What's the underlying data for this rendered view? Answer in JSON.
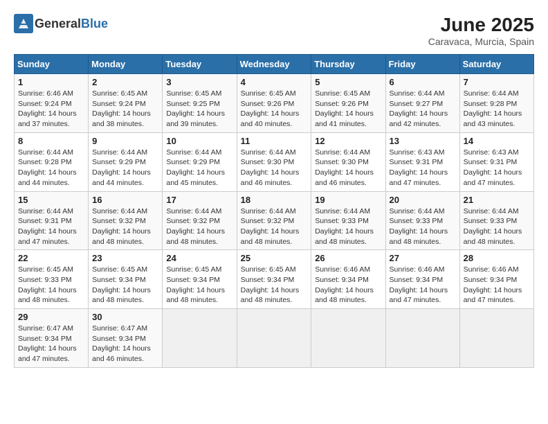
{
  "header": {
    "logo_general": "General",
    "logo_blue": "Blue",
    "month_year": "June 2025",
    "location": "Caravaca, Murcia, Spain"
  },
  "days_of_week": [
    "Sunday",
    "Monday",
    "Tuesday",
    "Wednesday",
    "Thursday",
    "Friday",
    "Saturday"
  ],
  "weeks": [
    [
      {
        "day": "1",
        "sunrise": "6:46 AM",
        "sunset": "9:24 PM",
        "daylight": "14 hours and 37 minutes."
      },
      {
        "day": "2",
        "sunrise": "6:45 AM",
        "sunset": "9:24 PM",
        "daylight": "14 hours and 38 minutes."
      },
      {
        "day": "3",
        "sunrise": "6:45 AM",
        "sunset": "9:25 PM",
        "daylight": "14 hours and 39 minutes."
      },
      {
        "day": "4",
        "sunrise": "6:45 AM",
        "sunset": "9:26 PM",
        "daylight": "14 hours and 40 minutes."
      },
      {
        "day": "5",
        "sunrise": "6:45 AM",
        "sunset": "9:26 PM",
        "daylight": "14 hours and 41 minutes."
      },
      {
        "day": "6",
        "sunrise": "6:44 AM",
        "sunset": "9:27 PM",
        "daylight": "14 hours and 42 minutes."
      },
      {
        "day": "7",
        "sunrise": "6:44 AM",
        "sunset": "9:28 PM",
        "daylight": "14 hours and 43 minutes."
      }
    ],
    [
      {
        "day": "8",
        "sunrise": "6:44 AM",
        "sunset": "9:28 PM",
        "daylight": "14 hours and 44 minutes."
      },
      {
        "day": "9",
        "sunrise": "6:44 AM",
        "sunset": "9:29 PM",
        "daylight": "14 hours and 44 minutes."
      },
      {
        "day": "10",
        "sunrise": "6:44 AM",
        "sunset": "9:29 PM",
        "daylight": "14 hours and 45 minutes."
      },
      {
        "day": "11",
        "sunrise": "6:44 AM",
        "sunset": "9:30 PM",
        "daylight": "14 hours and 46 minutes."
      },
      {
        "day": "12",
        "sunrise": "6:44 AM",
        "sunset": "9:30 PM",
        "daylight": "14 hours and 46 minutes."
      },
      {
        "day": "13",
        "sunrise": "6:43 AM",
        "sunset": "9:31 PM",
        "daylight": "14 hours and 47 minutes."
      },
      {
        "day": "14",
        "sunrise": "6:43 AM",
        "sunset": "9:31 PM",
        "daylight": "14 hours and 47 minutes."
      }
    ],
    [
      {
        "day": "15",
        "sunrise": "6:44 AM",
        "sunset": "9:31 PM",
        "daylight": "14 hours and 47 minutes."
      },
      {
        "day": "16",
        "sunrise": "6:44 AM",
        "sunset": "9:32 PM",
        "daylight": "14 hours and 48 minutes."
      },
      {
        "day": "17",
        "sunrise": "6:44 AM",
        "sunset": "9:32 PM",
        "daylight": "14 hours and 48 minutes."
      },
      {
        "day": "18",
        "sunrise": "6:44 AM",
        "sunset": "9:32 PM",
        "daylight": "14 hours and 48 minutes."
      },
      {
        "day": "19",
        "sunrise": "6:44 AM",
        "sunset": "9:33 PM",
        "daylight": "14 hours and 48 minutes."
      },
      {
        "day": "20",
        "sunrise": "6:44 AM",
        "sunset": "9:33 PM",
        "daylight": "14 hours and 48 minutes."
      },
      {
        "day": "21",
        "sunrise": "6:44 AM",
        "sunset": "9:33 PM",
        "daylight": "14 hours and 48 minutes."
      }
    ],
    [
      {
        "day": "22",
        "sunrise": "6:45 AM",
        "sunset": "9:33 PM",
        "daylight": "14 hours and 48 minutes."
      },
      {
        "day": "23",
        "sunrise": "6:45 AM",
        "sunset": "9:34 PM",
        "daylight": "14 hours and 48 minutes."
      },
      {
        "day": "24",
        "sunrise": "6:45 AM",
        "sunset": "9:34 PM",
        "daylight": "14 hours and 48 minutes."
      },
      {
        "day": "25",
        "sunrise": "6:45 AM",
        "sunset": "9:34 PM",
        "daylight": "14 hours and 48 minutes."
      },
      {
        "day": "26",
        "sunrise": "6:46 AM",
        "sunset": "9:34 PM",
        "daylight": "14 hours and 48 minutes."
      },
      {
        "day": "27",
        "sunrise": "6:46 AM",
        "sunset": "9:34 PM",
        "daylight": "14 hours and 47 minutes."
      },
      {
        "day": "28",
        "sunrise": "6:46 AM",
        "sunset": "9:34 PM",
        "daylight": "14 hours and 47 minutes."
      }
    ],
    [
      {
        "day": "29",
        "sunrise": "6:47 AM",
        "sunset": "9:34 PM",
        "daylight": "14 hours and 47 minutes."
      },
      {
        "day": "30",
        "sunrise": "6:47 AM",
        "sunset": "9:34 PM",
        "daylight": "14 hours and 46 minutes."
      },
      null,
      null,
      null,
      null,
      null
    ]
  ]
}
